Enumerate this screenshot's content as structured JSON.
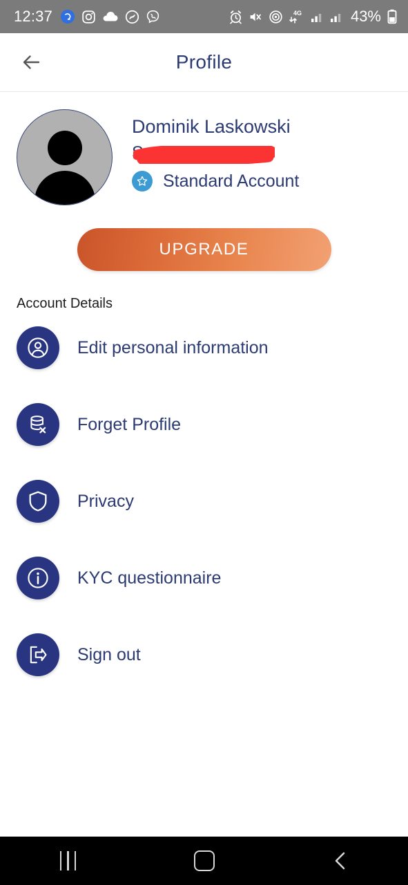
{
  "status_bar": {
    "time": "12:37",
    "battery_text": "43%",
    "left_icons": [
      "blue-badge-icon",
      "instagram-icon",
      "cloud-icon",
      "shazam-icon",
      "viber-icon"
    ],
    "right_icons": [
      "alarm-icon",
      "mute-vibrate-icon",
      "hotspot-icon",
      "network-4g-icon",
      "signal-bars-icon",
      "signal-bars-2-icon",
      "battery-icon"
    ],
    "background_color": "#7b7b7b"
  },
  "header": {
    "title": "Profile",
    "back_icon": "arrow-left-icon",
    "title_color": "#2b3a72"
  },
  "profile": {
    "name": "Dominik Laskowski",
    "redacted_text": "S",
    "redaction_color": "#fc3333",
    "account_type": "Standard Account",
    "badge_icon": "star-icon",
    "badge_color": "#3d9bd4",
    "avatar_icon": "person-avatar-icon",
    "avatar_color": "#b1b1b1"
  },
  "upgrade": {
    "label": "UPGRADE",
    "gradient_from": "#c9542a",
    "gradient_to": "#f2a173"
  },
  "account_details": {
    "section_label": "Account Details",
    "icon_color": "#2a3582",
    "items": [
      {
        "label": "Edit personal information",
        "icon": "user-circle-icon"
      },
      {
        "label": "Forget Profile",
        "icon": "database-remove-icon"
      },
      {
        "label": "Privacy",
        "icon": "shield-icon"
      },
      {
        "label": "KYC questionnaire",
        "icon": "info-icon"
      },
      {
        "label": "Sign out",
        "icon": "sign-out-icon"
      }
    ]
  },
  "navbar": {
    "recents_icon": "recents-icon",
    "home_icon": "home-icon",
    "back_icon": "back-chevron-icon"
  }
}
